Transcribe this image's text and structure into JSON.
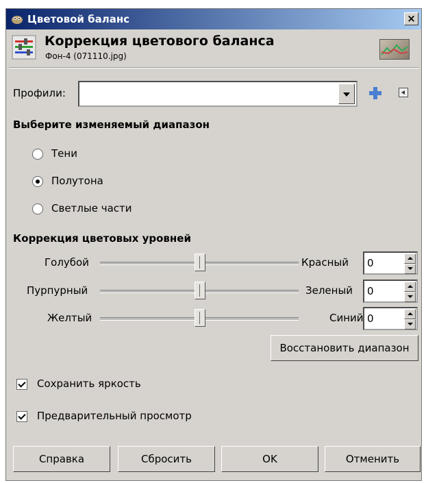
{
  "window": {
    "title": "Цветовой баланс",
    "close_label": "×"
  },
  "header": {
    "title": "Коррекция цветового баланса",
    "subtitle": "Фон-4 (071110.jpg)"
  },
  "profiles": {
    "label": "Профили:",
    "value": ""
  },
  "range": {
    "heading": "Выберите изменяемый диапазон",
    "options": [
      {
        "label": "Тени",
        "selected": false
      },
      {
        "label": "Полутона",
        "selected": true
      },
      {
        "label": "Светлые части",
        "selected": false
      }
    ]
  },
  "levels": {
    "heading": "Коррекция цветовых уровней",
    "rows": [
      {
        "left": "Голубой",
        "right": "Красный",
        "value": "0"
      },
      {
        "left": "Пурпурный",
        "right": "Зеленый",
        "value": "0"
      },
      {
        "left": "Желтый",
        "right": "Синий",
        "value": "0"
      }
    ],
    "reset_range_label": "Восстановить диапазон"
  },
  "options": {
    "preserve_luminosity": {
      "label": "Сохранить яркость",
      "checked": true
    },
    "preview": {
      "label": "Предварительный просмотр",
      "checked": true
    }
  },
  "buttons": {
    "help": "Справка",
    "reset": "Сбросить",
    "ok": "OK",
    "cancel": "Отменить"
  },
  "colors": {
    "titlebar_start": "#0a246a",
    "titlebar_end": "#a6caf0",
    "dialog_bg": "#d6d3ce"
  }
}
